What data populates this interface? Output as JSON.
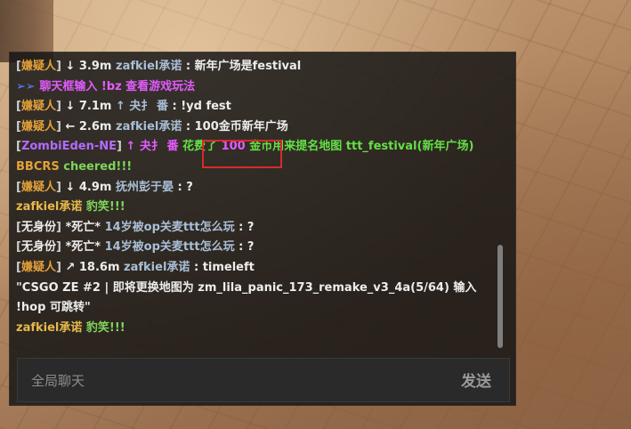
{
  "messages": [
    {
      "tag": "嫌疑人",
      "arrow": "↓",
      "dist": "3.9m",
      "name": "zafkiel承诺",
      "text": "新年广场是festival"
    },
    {
      "prefix": "➢➢",
      "text": "聊天框输入 !bz 查看游戏玩法"
    },
    {
      "tag": "嫌疑人",
      "arrow": "↓",
      "dist": "7.1m",
      "extra": "↑ 夬扌 番",
      "text": "!yd fest"
    },
    {
      "tag": "嫌疑人",
      "arrow": "←",
      "dist": "2.6m",
      "name": "zafkiel承诺",
      "text": "100金币新年广场"
    },
    {
      "tag": "ZombiEden-NE",
      "extra": "↑ 夬扌 番",
      "pre": "花费了",
      "amount": "100",
      "mid": "金币用来提名地图",
      "map": "ttt_festival(新年广场)"
    },
    {
      "name": "BBCRS",
      "text": "cheered!!!"
    },
    {
      "tag": "嫌疑人",
      "arrow": "↓",
      "dist": "4.9m",
      "name": "抚州彭于晏",
      "text": "?"
    },
    {
      "name": "zafkiel承诺",
      "text": "豹笑!!!"
    },
    {
      "tag": "无身份",
      "victim": "*死亡*",
      "name": "14岁被op关麦ttt怎么玩",
      "text": "?"
    },
    {
      "tag": "无身份",
      "victim": "*死亡*",
      "name": "14岁被op关麦ttt怎么玩",
      "text": "?"
    },
    {
      "tag": "嫌疑人",
      "arrow": "↗",
      "dist": "18.6m",
      "name": "zafkiel承诺",
      "text": "timeleft"
    },
    {
      "text": "\"CSGO ZE #2 | 即将更换地图为 zm_lila_panic_173_remake_v3_4a(5/64) 输入 !hop 可跳转\""
    },
    {
      "name": "zafkiel承诺",
      "text": "豹笑!!!"
    }
  ],
  "input": {
    "placeholder": "全局聊天",
    "value": ""
  },
  "send_label": "发送",
  "colors": {
    "tag": "#e3a13a",
    "purple_tag": "#b36bff",
    "name": "#a9bfd6",
    "magenta": "#e35cff",
    "green": "#63e045",
    "highlight": "#d62a2a"
  }
}
